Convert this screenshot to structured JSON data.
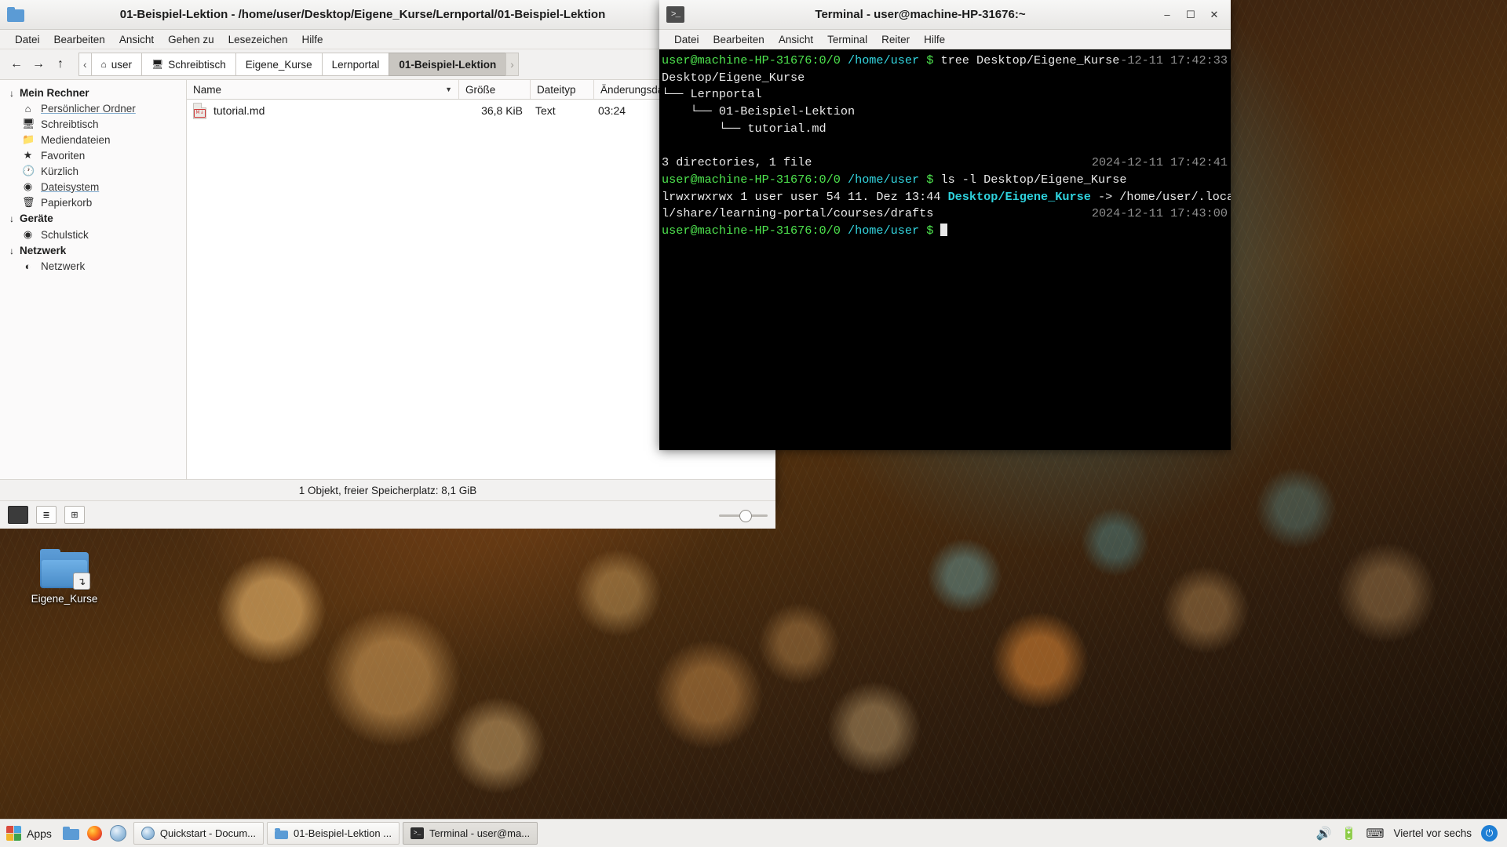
{
  "desktop": {
    "icon": {
      "label": "Eigene_Kurse",
      "icon_name": "folder-symlink-icon",
      "link_badge": "↴"
    }
  },
  "file_manager": {
    "window_title": "01-Beispiel-Lektion - /home/user/Desktop/Eigene_Kurse/Lernportal/01-Beispiel-Lektion",
    "window_icon": "folder-icon",
    "window_buttons": {
      "minimize": "–",
      "maximize": "☐",
      "close": "✕"
    },
    "menu": [
      "Datei",
      "Bearbeiten",
      "Ansicht",
      "Gehen zu",
      "Lesezeichen",
      "Hilfe"
    ],
    "toolbar": {
      "back": "←",
      "forward": "→",
      "up": "↑"
    },
    "breadcrumbs": {
      "scroll_left": "‹",
      "scroll_right": "›",
      "items": [
        {
          "label": "user",
          "icon": "home-icon",
          "active": false
        },
        {
          "label": "Schreibtisch",
          "icon": "desktop-icon",
          "active": false
        },
        {
          "label": "Eigene_Kurse",
          "icon": "",
          "active": false
        },
        {
          "label": "Lernportal",
          "icon": "",
          "active": false
        },
        {
          "label": "01-Beispiel-Lektion",
          "icon": "",
          "active": true
        }
      ]
    },
    "sidebar": {
      "groups": [
        {
          "title": "Mein Rechner",
          "chevron": "↓",
          "items": [
            {
              "label": "Persönlicher Ordner",
              "icon": "home-icon",
              "linked": true
            },
            {
              "label": "Schreibtisch",
              "icon": "desktop-icon",
              "linked": false
            },
            {
              "label": "Mediendateien",
              "icon": "folder-icon",
              "linked": false
            },
            {
              "label": "Favoriten",
              "icon": "star-icon",
              "linked": false
            },
            {
              "label": "Kürzlich",
              "icon": "clock-icon",
              "linked": false
            },
            {
              "label": "Dateisystem",
              "icon": "drive-icon",
              "linked": true
            },
            {
              "label": "Papierkorb",
              "icon": "trash-icon",
              "linked": false
            }
          ]
        },
        {
          "title": "Geräte",
          "chevron": "↓",
          "items": [
            {
              "label": "Schulstick",
              "icon": "usb-drive-icon",
              "linked": false
            }
          ]
        },
        {
          "title": "Netzwerk",
          "chevron": "↓",
          "items": [
            {
              "label": "Netzwerk",
              "icon": "network-icon",
              "linked": false
            }
          ]
        }
      ]
    },
    "columns": {
      "name": "Name",
      "size": "Größe",
      "type": "Dateityp",
      "modified": "Änderungsdatum",
      "sort_indicator": "▼"
    },
    "files": [
      {
        "name": "tutorial.md",
        "size": "36,8 KiB",
        "type": "Text",
        "modified": "03:24",
        "icon": "markdown-file-icon",
        "icon_badge": "M↓"
      }
    ],
    "statusbar": "1 Objekt, freier Speicherplatz: 8,1 GiB",
    "bottom_toolbar": {
      "icon_view": "■",
      "detailed_view": "≣",
      "compact_view": "⊞",
      "zoom_label": ""
    }
  },
  "terminal": {
    "window_title": "Terminal - user@machine-HP-31676:~",
    "window_icon": "terminal-icon",
    "icon_glyph": ">_",
    "window_buttons": {
      "minimize": "–",
      "maximize": "☐",
      "close": "✕"
    },
    "menu": [
      "Datei",
      "Bearbeiten",
      "Ansicht",
      "Terminal",
      "Reiter",
      "Hilfe"
    ],
    "lines": [
      {
        "segments": [
          {
            "text": "user@machine-HP-31676:0/0 ",
            "color": "green"
          },
          {
            "text": "/home/user ",
            "color": "cyan"
          },
          {
            "text": "$ ",
            "color": "green"
          },
          {
            "text": "tree Desktop/Eigene_Kurse",
            "color": "white"
          }
        ],
        "timestamp": "-12-11 17:42:33"
      },
      {
        "segments": [
          {
            "text": "Desktop/Eigene_Kurse",
            "color": "white"
          }
        ],
        "timestamp": ""
      },
      {
        "segments": [
          {
            "text": "└── Lernportal",
            "color": "white"
          }
        ],
        "timestamp": ""
      },
      {
        "segments": [
          {
            "text": "    └── 01-Beispiel-Lektion",
            "color": "white"
          }
        ],
        "timestamp": ""
      },
      {
        "segments": [
          {
            "text": "        └── tutorial.md",
            "color": "white"
          }
        ],
        "timestamp": ""
      },
      {
        "segments": [
          {
            "text": "",
            "color": "white"
          }
        ],
        "timestamp": ""
      },
      {
        "segments": [
          {
            "text": "3 directories, 1 file",
            "color": "white"
          }
        ],
        "timestamp": "2024-12-11 17:42:41"
      },
      {
        "segments": [
          {
            "text": "user@machine-HP-31676:0/0 ",
            "color": "green"
          },
          {
            "text": "/home/user ",
            "color": "cyan"
          },
          {
            "text": "$ ",
            "color": "green"
          },
          {
            "text": "ls -l Desktop/Eigene_Kurse",
            "color": "white"
          }
        ],
        "timestamp": ""
      },
      {
        "segments": [
          {
            "text": "lrwxrwxrwx 1 user user 54 11. Dez 13:44 ",
            "color": "white"
          },
          {
            "text": "Desktop/Eigene_Kurse",
            "color": "cyanbold"
          },
          {
            "text": " -> /home/user/.loca",
            "color": "white"
          }
        ],
        "timestamp": ""
      },
      {
        "segments": [
          {
            "text": "l/share/learning-portal/courses/drafts",
            "color": "white"
          }
        ],
        "timestamp": "2024-12-11 17:43:00"
      },
      {
        "segments": [
          {
            "text": "user@machine-HP-31676:0/0 ",
            "color": "green"
          },
          {
            "text": "/home/user ",
            "color": "cyan"
          },
          {
            "text": "$ ",
            "color": "green"
          }
        ],
        "timestamp": "",
        "cursor": true
      }
    ]
  },
  "taskbar": {
    "apps_label": "Apps",
    "launchers": [
      {
        "name": "file-manager-launcher",
        "icon": "folder-icon"
      },
      {
        "name": "firefox-launcher",
        "icon": "firefox-icon"
      },
      {
        "name": "browser-launcher",
        "icon": "globe-icon"
      }
    ],
    "windows": [
      {
        "label": "Quickstart - Docum...",
        "icon": "globe-icon",
        "active": false
      },
      {
        "label": "01-Beispiel-Lektion ...",
        "icon": "folder-icon",
        "active": false
      },
      {
        "label": "Terminal - user@ma...",
        "icon": "terminal-icon",
        "active": true
      }
    ],
    "tray": {
      "volume_icon": "🔊",
      "battery_icon": "🔋",
      "keyboard_icon": "⌨",
      "clock": "Viertel vor sechs",
      "power_icon": "⏻"
    }
  },
  "colors": {
    "accent": "#5b9bd5",
    "terminal_green": "#4ee44e",
    "terminal_cyan": "#33d6e0",
    "terminal_gray": "#8f8f8f",
    "markdown_red": "#d03a3a"
  }
}
